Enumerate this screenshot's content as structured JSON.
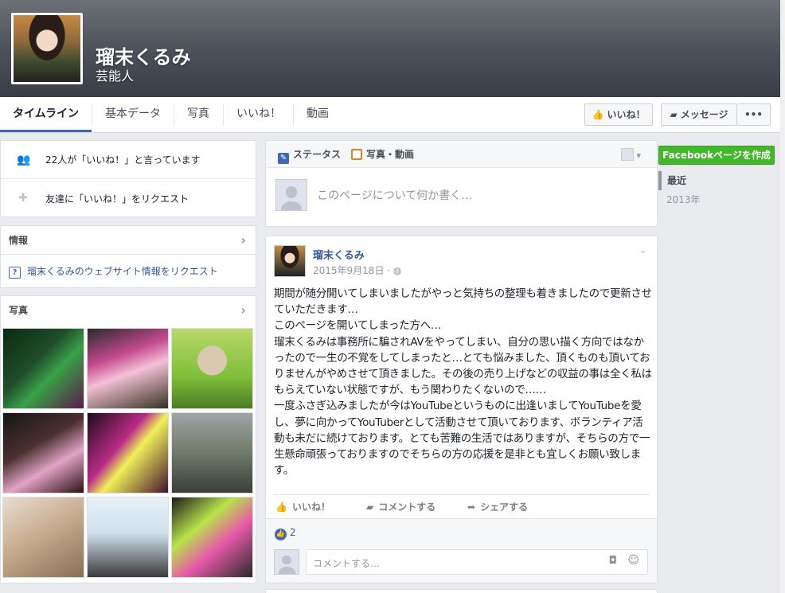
{
  "header": {
    "page_name": "瑠末くるみ",
    "category": "芸能人"
  },
  "nav": {
    "tabs": [
      "タイムライン",
      "基本データ",
      "写真",
      "いいね！",
      "動画"
    ],
    "like_button": "いいね！",
    "message_button": "メッセージ",
    "more_button": "•••"
  },
  "left": {
    "likes_text": "22人が「いいね！」と言っています",
    "invite_text": "友達に「いいね！」をリクエスト",
    "info_title": "情報",
    "website_request": "瑠末くるみのウェブサイト情報をリクエスト",
    "photos_title": "写真"
  },
  "composer": {
    "status_tab": "ステータス",
    "photo_tab": "写真・動画",
    "placeholder": "このページについて何か書く…"
  },
  "post": {
    "author": "瑠末くるみ",
    "date": "2015年9月18日",
    "paragraphs": [
      "期間が随分開いてしまいましたがやっと気持ちの整理も着きましたので更新させていただきます…",
      "このページを開いてしまった方へ…",
      "瑠末くるみは事務所に騙されAVをやってしまい、自分の思い描く方向ではなかったので一生の不覚をしてしまったと…とても悩みました、頂くものも頂いておりませんがやめさせて頂きました。その後の売り上げなどの収益の事は全く私はもらえていない状態ですが、もう関わりたくないので……",
      "一度ふさぎ込みましたが今はYouTubeというものに出逢いましてYouTubeを愛し、夢に向かってYouTuberとして活動させて頂いております、ボランティア活動も未だに続けております。とても苦難の生活ではありますが、そちらの方で一生懸命頑張っておりますのでそちらの方の応援を是非とも宜しくお願い致します。"
    ],
    "like_action": "いいね！",
    "comment_action": "コメントする",
    "share_action": "シェアする",
    "like_count": "2",
    "comment_placeholder": "コメントする…"
  },
  "right": {
    "create_page": "Facebookページを作成",
    "years": [
      "最近",
      "2013年"
    ]
  },
  "colors": {
    "accent": "#4267b2",
    "link": "#365899",
    "green": "#42b72a"
  }
}
